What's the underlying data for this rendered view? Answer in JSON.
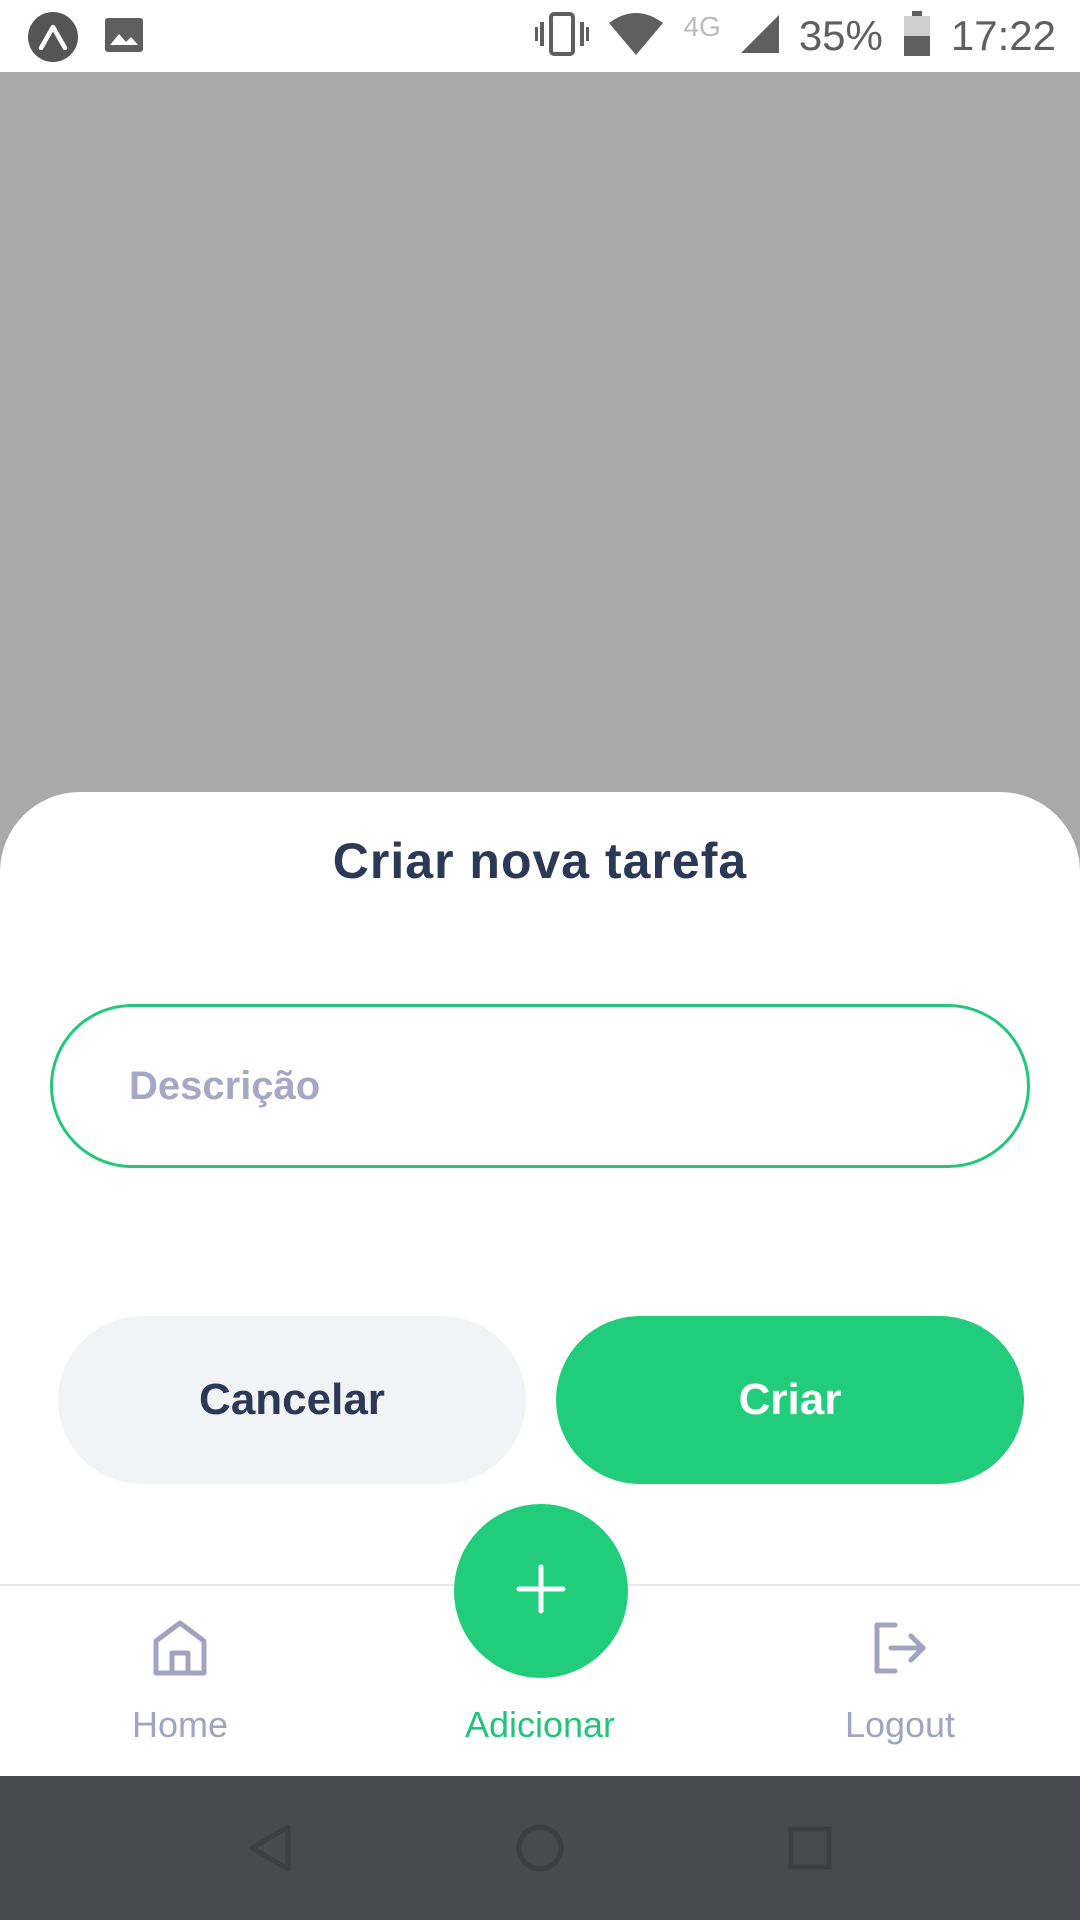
{
  "status_bar": {
    "battery": "35%",
    "time": "17:22",
    "network": "4G"
  },
  "sheet": {
    "title": "Criar nova tarefa",
    "description_placeholder": "Descrição",
    "description_value": "",
    "cancel_label": "Cancelar",
    "create_label": "Criar"
  },
  "tab_bar": {
    "items": [
      {
        "label": "Home",
        "icon": "home-icon"
      },
      {
        "label": "Adicionar",
        "icon": "plus-icon"
      },
      {
        "label": "Logout",
        "icon": "logout-icon"
      }
    ],
    "active_color": "#21C57A",
    "inactive_color": "#A1A4C0"
  },
  "colors": {
    "accent": "#21CC7A",
    "title": "#2B3856",
    "overlay": "#A9A9A9"
  }
}
